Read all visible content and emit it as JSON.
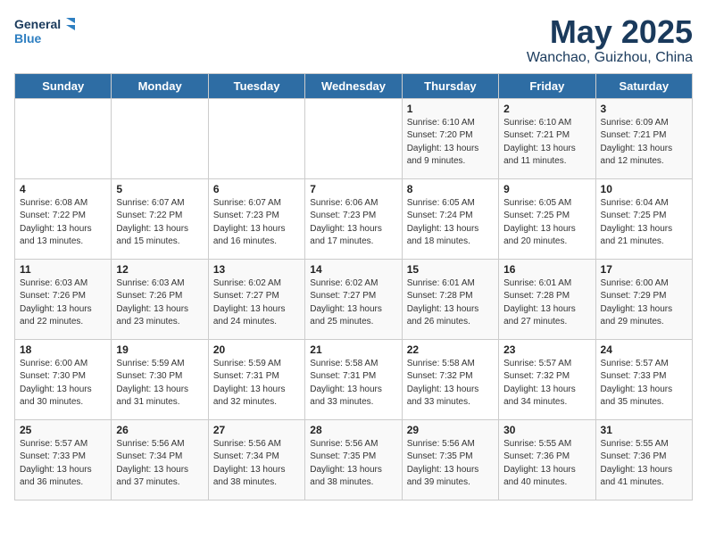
{
  "logo": {
    "line1": "General",
    "line2": "Blue"
  },
  "title": "May 2025",
  "subtitle": "Wanchao, Guizhou, China",
  "weekdays": [
    "Sunday",
    "Monday",
    "Tuesday",
    "Wednesday",
    "Thursday",
    "Friday",
    "Saturday"
  ],
  "weeks": [
    [
      {
        "day": "",
        "info": ""
      },
      {
        "day": "",
        "info": ""
      },
      {
        "day": "",
        "info": ""
      },
      {
        "day": "",
        "info": ""
      },
      {
        "day": "1",
        "info": "Sunrise: 6:10 AM\nSunset: 7:20 PM\nDaylight: 13 hours\nand 9 minutes."
      },
      {
        "day": "2",
        "info": "Sunrise: 6:10 AM\nSunset: 7:21 PM\nDaylight: 13 hours\nand 11 minutes."
      },
      {
        "day": "3",
        "info": "Sunrise: 6:09 AM\nSunset: 7:21 PM\nDaylight: 13 hours\nand 12 minutes."
      }
    ],
    [
      {
        "day": "4",
        "info": "Sunrise: 6:08 AM\nSunset: 7:22 PM\nDaylight: 13 hours\nand 13 minutes."
      },
      {
        "day": "5",
        "info": "Sunrise: 6:07 AM\nSunset: 7:22 PM\nDaylight: 13 hours\nand 15 minutes."
      },
      {
        "day": "6",
        "info": "Sunrise: 6:07 AM\nSunset: 7:23 PM\nDaylight: 13 hours\nand 16 minutes."
      },
      {
        "day": "7",
        "info": "Sunrise: 6:06 AM\nSunset: 7:23 PM\nDaylight: 13 hours\nand 17 minutes."
      },
      {
        "day": "8",
        "info": "Sunrise: 6:05 AM\nSunset: 7:24 PM\nDaylight: 13 hours\nand 18 minutes."
      },
      {
        "day": "9",
        "info": "Sunrise: 6:05 AM\nSunset: 7:25 PM\nDaylight: 13 hours\nand 20 minutes."
      },
      {
        "day": "10",
        "info": "Sunrise: 6:04 AM\nSunset: 7:25 PM\nDaylight: 13 hours\nand 21 minutes."
      }
    ],
    [
      {
        "day": "11",
        "info": "Sunrise: 6:03 AM\nSunset: 7:26 PM\nDaylight: 13 hours\nand 22 minutes."
      },
      {
        "day": "12",
        "info": "Sunrise: 6:03 AM\nSunset: 7:26 PM\nDaylight: 13 hours\nand 23 minutes."
      },
      {
        "day": "13",
        "info": "Sunrise: 6:02 AM\nSunset: 7:27 PM\nDaylight: 13 hours\nand 24 minutes."
      },
      {
        "day": "14",
        "info": "Sunrise: 6:02 AM\nSunset: 7:27 PM\nDaylight: 13 hours\nand 25 minutes."
      },
      {
        "day": "15",
        "info": "Sunrise: 6:01 AM\nSunset: 7:28 PM\nDaylight: 13 hours\nand 26 minutes."
      },
      {
        "day": "16",
        "info": "Sunrise: 6:01 AM\nSunset: 7:28 PM\nDaylight: 13 hours\nand 27 minutes."
      },
      {
        "day": "17",
        "info": "Sunrise: 6:00 AM\nSunset: 7:29 PM\nDaylight: 13 hours\nand 29 minutes."
      }
    ],
    [
      {
        "day": "18",
        "info": "Sunrise: 6:00 AM\nSunset: 7:30 PM\nDaylight: 13 hours\nand 30 minutes."
      },
      {
        "day": "19",
        "info": "Sunrise: 5:59 AM\nSunset: 7:30 PM\nDaylight: 13 hours\nand 31 minutes."
      },
      {
        "day": "20",
        "info": "Sunrise: 5:59 AM\nSunset: 7:31 PM\nDaylight: 13 hours\nand 32 minutes."
      },
      {
        "day": "21",
        "info": "Sunrise: 5:58 AM\nSunset: 7:31 PM\nDaylight: 13 hours\nand 33 minutes."
      },
      {
        "day": "22",
        "info": "Sunrise: 5:58 AM\nSunset: 7:32 PM\nDaylight: 13 hours\nand 33 minutes."
      },
      {
        "day": "23",
        "info": "Sunrise: 5:57 AM\nSunset: 7:32 PM\nDaylight: 13 hours\nand 34 minutes."
      },
      {
        "day": "24",
        "info": "Sunrise: 5:57 AM\nSunset: 7:33 PM\nDaylight: 13 hours\nand 35 minutes."
      }
    ],
    [
      {
        "day": "25",
        "info": "Sunrise: 5:57 AM\nSunset: 7:33 PM\nDaylight: 13 hours\nand 36 minutes."
      },
      {
        "day": "26",
        "info": "Sunrise: 5:56 AM\nSunset: 7:34 PM\nDaylight: 13 hours\nand 37 minutes."
      },
      {
        "day": "27",
        "info": "Sunrise: 5:56 AM\nSunset: 7:34 PM\nDaylight: 13 hours\nand 38 minutes."
      },
      {
        "day": "28",
        "info": "Sunrise: 5:56 AM\nSunset: 7:35 PM\nDaylight: 13 hours\nand 38 minutes."
      },
      {
        "day": "29",
        "info": "Sunrise: 5:56 AM\nSunset: 7:35 PM\nDaylight: 13 hours\nand 39 minutes."
      },
      {
        "day": "30",
        "info": "Sunrise: 5:55 AM\nSunset: 7:36 PM\nDaylight: 13 hours\nand 40 minutes."
      },
      {
        "day": "31",
        "info": "Sunrise: 5:55 AM\nSunset: 7:36 PM\nDaylight: 13 hours\nand 41 minutes."
      }
    ]
  ]
}
